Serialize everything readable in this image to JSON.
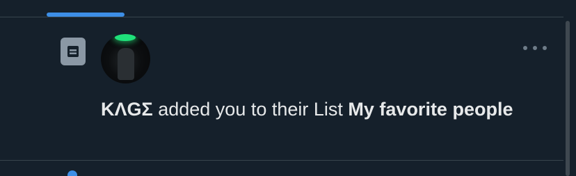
{
  "notification": {
    "user_name": "ΚΛGΣ",
    "action_text": " added you to their List ",
    "list_name": "My favorite people",
    "type_icon": "list-icon",
    "menu_icon": "more-horizontal-icon"
  },
  "colors": {
    "background": "#15202b",
    "divider": "#38444d",
    "accent": "#3d8ee6",
    "icon_gray": "#8b98a5",
    "text": "#e7e9ea"
  }
}
